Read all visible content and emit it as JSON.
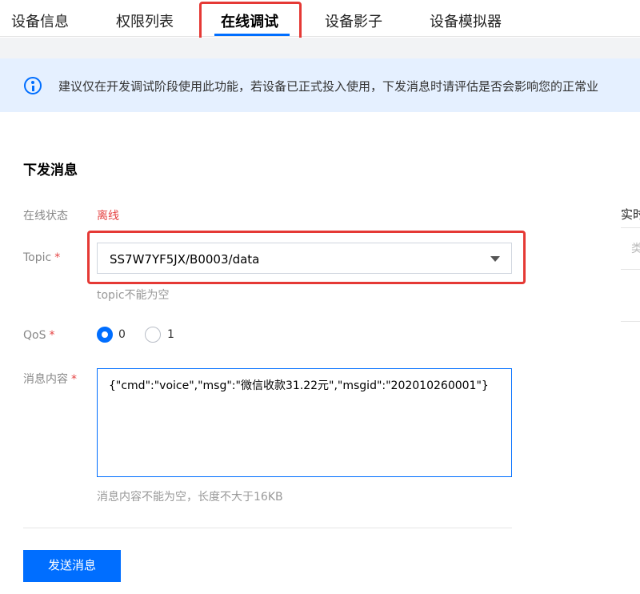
{
  "tabs": [
    {
      "label": "设备信息",
      "active": false
    },
    {
      "label": "权限列表",
      "active": false
    },
    {
      "label": "在线调试",
      "active": true
    },
    {
      "label": "设备影子",
      "active": false
    },
    {
      "label": "设备模拟器",
      "active": false
    }
  ],
  "banner": {
    "icon": "info-icon",
    "text": "建议仅在开发调试阶段使用此功能，若设备已正式投入使用，下发消息时请评估是否会影响您的正常业"
  },
  "form": {
    "title": "下发消息",
    "status_label": "在线状态",
    "status_value": "离线",
    "status_color": "#e54545",
    "topic_label": "Topic",
    "required_mark": "*",
    "topic_value": "SS7W7YF5JX/B0003/data",
    "topic_hint": "topic不能为空",
    "qos_label": "QoS",
    "qos_options": [
      "0",
      "1"
    ],
    "qos_selected": "0",
    "content_label": "消息内容",
    "content_value": "{\"cmd\":\"voice\",\"msg\":\"微信收款31.22元\",\"msgid\":\"202010260001\"}",
    "content_hint": "消息内容不能为空，长度不大于16KB",
    "send_button": "发送消息"
  },
  "right_panel": {
    "title": "实时",
    "column": "类"
  },
  "colors": {
    "accent": "#006eff",
    "highlight": "#e53935",
    "banner_bg": "#e5f0ff"
  }
}
